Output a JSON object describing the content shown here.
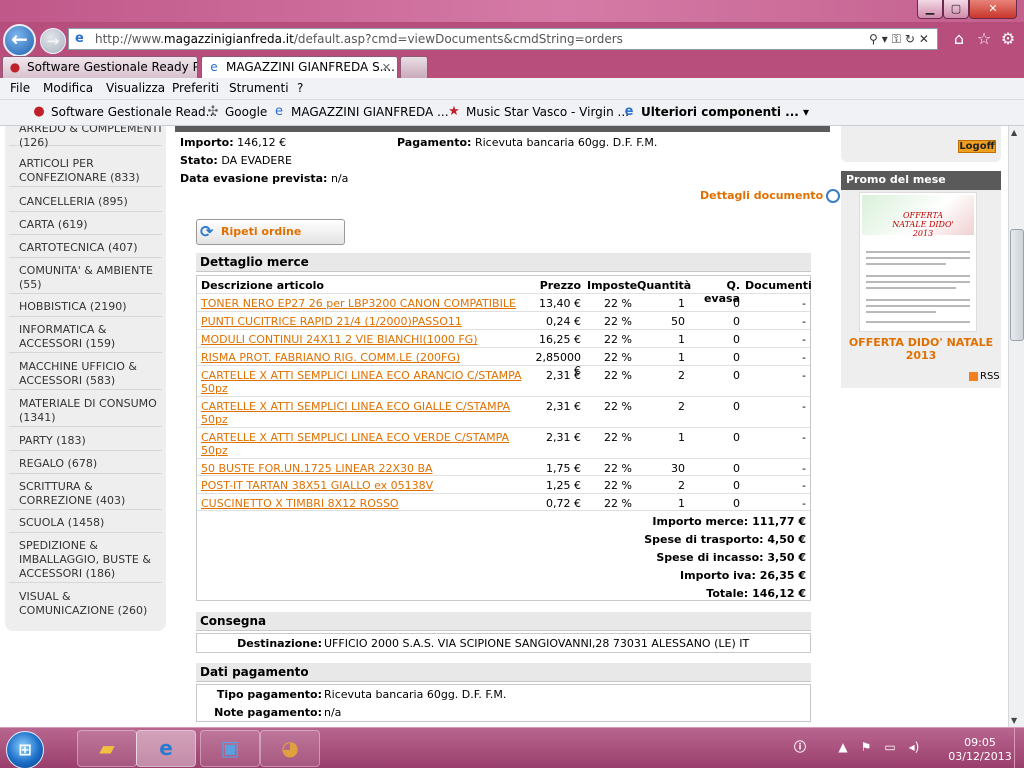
{
  "browser": {
    "url_prefix": "http://www.",
    "url_domain": "magazzinigianfreda.it",
    "url_rest": "/default.asp?cmd=viewDocuments&cmdString=orders",
    "tabs": [
      {
        "label": "Software Gestionale Ready Pro ..."
      },
      {
        "label": "MAGAZZINI GIANFREDA S...."
      }
    ],
    "menu": [
      "File",
      "Modifica",
      "Visualizza",
      "Preferiti",
      "Strumenti",
      "?"
    ],
    "favorites": [
      {
        "label": "Software Gestionale Read..."
      },
      {
        "label": "Google"
      },
      {
        "label": "MAGAZZINI GIANFREDA ..."
      },
      {
        "label": "Music Star Vasco - Virgin ..."
      },
      {
        "label": "Ulteriori componenti ..."
      }
    ]
  },
  "sidebar": {
    "categories": [
      {
        "label": "ARREDO & COMPLEMENTI",
        "count": "(126)"
      },
      {
        "label": "ARTICOLI PER CONFEZIONARE (833)"
      },
      {
        "label": "CANCELLERIA (895)"
      },
      {
        "label": "CARTA (619)"
      },
      {
        "label": "CARTOTECNICA (407)"
      },
      {
        "label": "COMUNITA' & AMBIENTE",
        "count": "(55)"
      },
      {
        "label": "HOBBISTICA (2190)"
      },
      {
        "label": "INFORMATICA & ACCESSORI (159)"
      },
      {
        "label": "MACCHINE UFFICIO & ACCESSORI (583)"
      },
      {
        "label": "MATERIALE DI CONSUMO (1341)"
      },
      {
        "label": "PARTY (183)"
      },
      {
        "label": "REGALO (678)"
      },
      {
        "label": "SCRITTURA & CORREZIONE (403)"
      },
      {
        "label": "SCUOLA (1458)"
      },
      {
        "label": "SPEDIZIONE & IMBALLAGGIO, BUSTE & ACCESSORI (186)"
      },
      {
        "label": "VISUAL & COMUNICAZIONE (260)"
      }
    ]
  },
  "order": {
    "importo_label": "Importo:",
    "importo_value": "146,12 €",
    "pagamento_label": "Pagamento:",
    "pagamento_value": "Ricevuta bancaria 60gg. D.F. F.M.",
    "stato_label": "Stato:",
    "stato_value": "DA EVADERE",
    "evasione_label": "Data evasione prevista:",
    "evasione_value": "n/a",
    "dettagli_link": "Dettagli documento",
    "ripeti_label": "Ripeti ordine"
  },
  "dettaglio": {
    "title": "Dettaglio merce",
    "headers": {
      "desc": "Descrizione articolo",
      "prezzo": "Prezzo",
      "imposte": "Imposte",
      "quantita": "Quantità",
      "evasa": "Q. evasa",
      "documenti": "Documenti"
    },
    "rows": [
      {
        "desc": "TONER NERO EP27 26 per LBP3200 CANON COMPATIBILE",
        "prezzo": "13,40 €",
        "imposte": "22 %",
        "qty": "1",
        "evasa": "0",
        "doc": "-"
      },
      {
        "desc": "PUNTI CUCITRICE RAPID 21/4 (1/2000)PASSO11",
        "prezzo": "0,24 €",
        "imposte": "22 %",
        "qty": "50",
        "evasa": "0",
        "doc": "-"
      },
      {
        "desc": "MODULI CONTINUI 24X11 2 VIE BIANCHI(1000 FG)",
        "prezzo": "16,25 €",
        "imposte": "22 %",
        "qty": "1",
        "evasa": "0",
        "doc": "-"
      },
      {
        "desc": "RISMA PROT. FABRIANO RIG. COMM.LE (200FG)",
        "prezzo": "2,85000 €",
        "imposte": "22 %",
        "qty": "1",
        "evasa": "0",
        "doc": "-"
      },
      {
        "desc": "CARTELLE X ATTI SEMPLICI LINEA ECO ARANCIO C/STAMPA 50pz",
        "prezzo": "2,31 €",
        "imposte": "22 %",
        "qty": "2",
        "evasa": "0",
        "doc": "-"
      },
      {
        "desc": "CARTELLE X ATTI SEMPLICI LINEA ECO GIALLE C/STAMPA 50pz",
        "prezzo": "2,31 €",
        "imposte": "22 %",
        "qty": "2",
        "evasa": "0",
        "doc": "-"
      },
      {
        "desc": "CARTELLE X ATTI SEMPLICI LINEA ECO VERDE C/STAMPA 50pz",
        "prezzo": "2,31 €",
        "imposte": "22 %",
        "qty": "1",
        "evasa": "0",
        "doc": "-"
      },
      {
        "desc": "50 BUSTE FOR.UN.1725 LINEAR 22X30 BA",
        "prezzo": "1,75 €",
        "imposte": "22 %",
        "qty": "30",
        "evasa": "0",
        "doc": "-"
      },
      {
        "desc": "POST-IT TARTAN 38X51 GIALLO ex 05138V",
        "prezzo": "1,25 €",
        "imposte": "22 %",
        "qty": "2",
        "evasa": "0",
        "doc": "-"
      },
      {
        "desc": "CUSCINETTO X TIMBRI 8X12 ROSSO",
        "prezzo": "0,72 €",
        "imposte": "22 %",
        "qty": "1",
        "evasa": "0",
        "doc": "-"
      }
    ],
    "totals": [
      {
        "label": "Importo merce:",
        "value": "111,77 €"
      },
      {
        "label": "Spese di trasporto:",
        "value": "4,50 €"
      },
      {
        "label": "Spese di incasso:",
        "value": "3,50 €"
      },
      {
        "label": "Importo iva:",
        "value": "26,35 €"
      },
      {
        "label": "Totale:",
        "value": "146,12 €"
      }
    ]
  },
  "consegna": {
    "title": "Consegna",
    "destinazione_label": "Destinazione:",
    "destinazione_value": "UFFICIO 2000 S.A.S. VIA SCIPIONE SANGIOVANNI,28 73031 ALESSANO (LE) IT"
  },
  "pagamento": {
    "title": "Dati pagamento",
    "tipo_label": "Tipo pagamento:",
    "tipo_value": "Ricevuta bancaria 60gg. D.F. F.M.",
    "note_label": "Note pagamento:",
    "note_value": "n/a"
  },
  "right": {
    "logoff": "Logoff",
    "promo_head": "Promo del mese",
    "promo_art_text": "OFFERTA NATALE DIDO' 2013",
    "promo_title": "OFFERTA DIDO' NATALE 2013",
    "rss": "RSS"
  },
  "taskbar": {
    "time": "09:05",
    "date": "03/12/2013"
  },
  "colors": {
    "accent": "#e07000",
    "header_bg": "#5a5a5a",
    "sidebar_bg": "#eeeeee"
  }
}
